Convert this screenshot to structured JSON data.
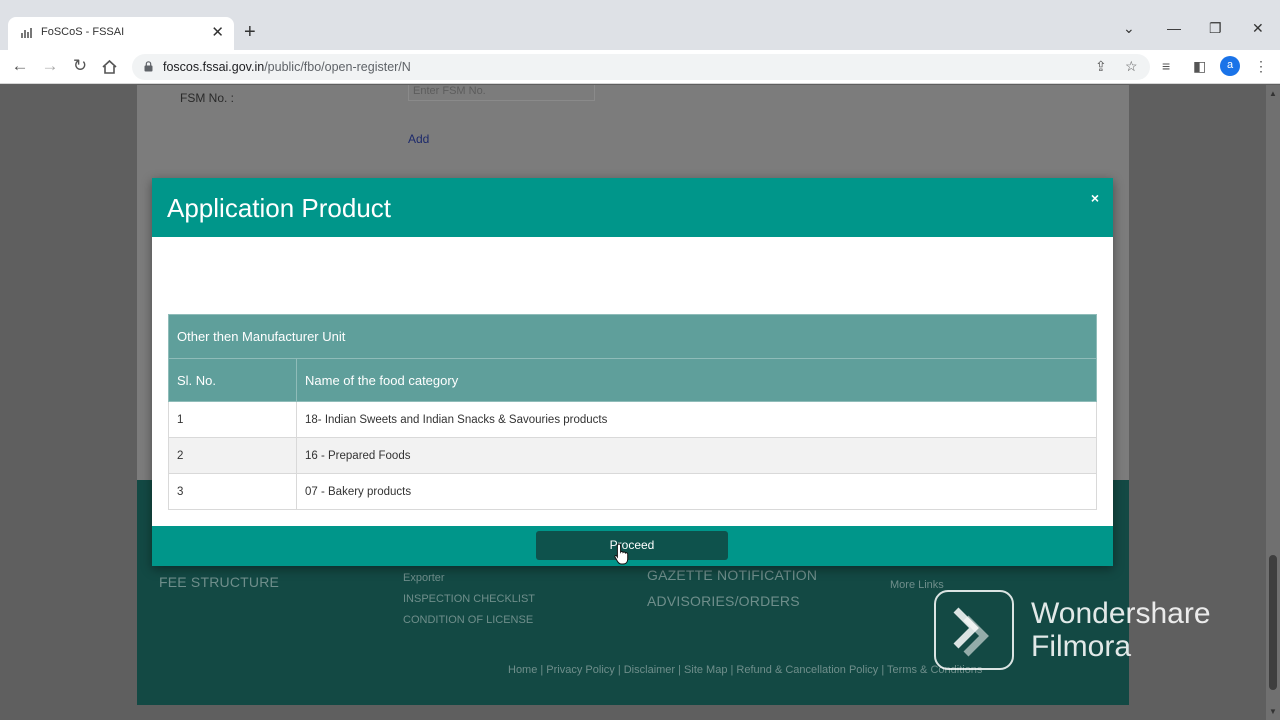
{
  "browser": {
    "tab_title": "FoSCoS - FSSAI",
    "url_host": "foscos.fssai.gov.in",
    "url_path": "/public/fbo/open-register/N",
    "profile_initial": "a"
  },
  "page": {
    "fsm_label": "FSM No. :",
    "fsm_placeholder": "Enter FSM No.",
    "add_link": "Add",
    "footer": {
      "fee_structure": "FEE STRUCTURE",
      "exporter": "Exporter",
      "inspection_checklist": "INSPECTION CHECKLIST",
      "condition_of_license": "CONDITION OF LICENSE",
      "gazette_notification": "GAZETTE NOTIFICATION",
      "advisories_orders": "ADVISORIES/ORDERS",
      "more_links": "More Links",
      "bottom_links": "Home | Privacy Policy | Disclaimer | Site Map | Refund & Cancellation Policy | Terms & Conditions"
    }
  },
  "modal": {
    "title": "Application Product",
    "close": "×",
    "table_caption": "Other then Manufacturer Unit",
    "columns": [
      "Sl. No.",
      "Name of the food category"
    ],
    "rows": [
      {
        "no": "1",
        "category": "18- Indian Sweets and Indian Snacks & Savouries products"
      },
      {
        "no": "2",
        "category": "16 - Prepared Foods"
      },
      {
        "no": "3",
        "category": "07 - Bakery products"
      }
    ],
    "proceed_label": "Proceed"
  },
  "watermark": {
    "line1": "Wondershare",
    "line2": "Filmora"
  },
  "colors": {
    "modal_teal": "#00968a",
    "table_header": "#5f9f9b",
    "proceed_button": "#0e524c",
    "footer_teal": "#134944"
  }
}
